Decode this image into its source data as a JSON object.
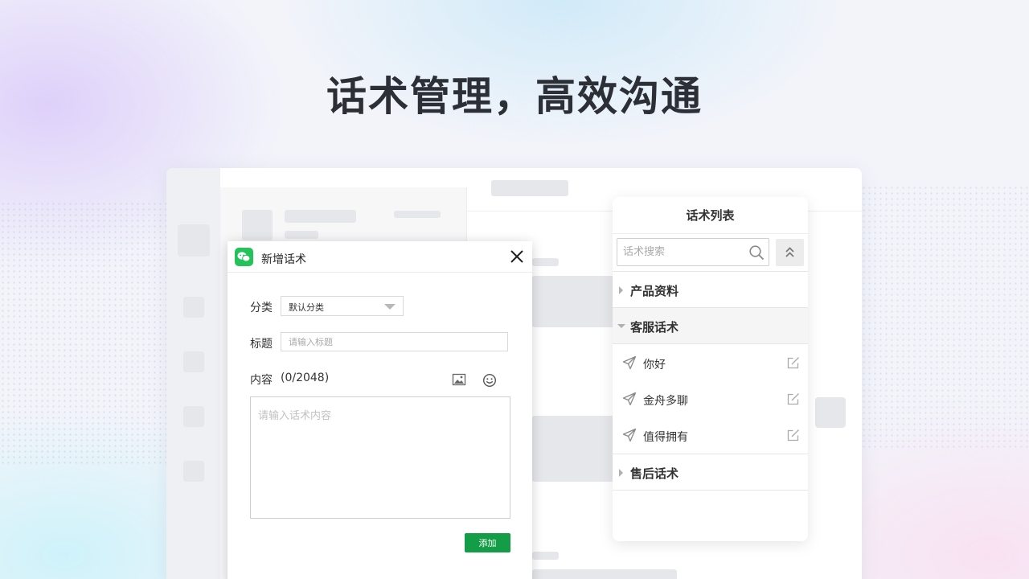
{
  "headline": "话术管理，高效沟通",
  "dialog": {
    "title": "新增话术",
    "category_label": "分类",
    "category_value": "默认分类",
    "title_label": "标题",
    "title_placeholder": "请输入标题",
    "content_label": "内容",
    "content_count": "(0/2048)",
    "content_placeholder": "请输入话术内容",
    "add_button": "添加",
    "accent_color": "#129d46",
    "logo_color": "#23c25a"
  },
  "panel": {
    "title": "话术列表",
    "search_placeholder": "话术搜索",
    "categories": [
      {
        "label": "产品资料",
        "expanded": false
      },
      {
        "label": "客服话术",
        "expanded": true,
        "items": [
          "你好",
          "金舟多聊",
          "值得拥有"
        ]
      },
      {
        "label": "售后话术",
        "expanded": false
      }
    ]
  },
  "icons": {
    "close": "close-icon",
    "image": "image-icon",
    "emoji": "emoji-icon",
    "search": "search-icon",
    "collapse": "double-chevron-up-icon",
    "send": "send-icon",
    "edit": "edit-icon"
  }
}
